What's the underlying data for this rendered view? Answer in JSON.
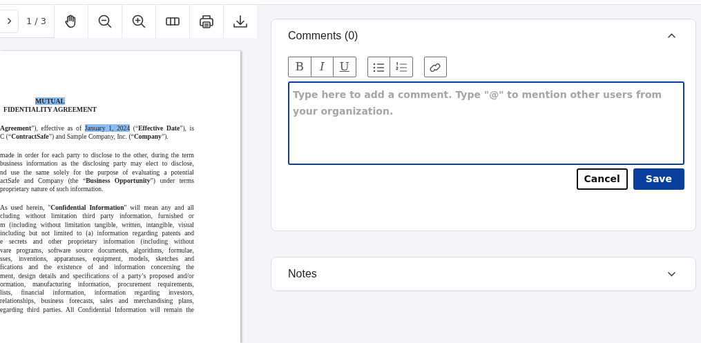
{
  "viewer": {
    "toolbar": {
      "page_indicator": "1 / 3",
      "tools": [
        {
          "kind": "hand"
        },
        {
          "kind": "zoom-out"
        },
        {
          "kind": "zoom-in"
        },
        {
          "kind": "columns"
        },
        {
          "kind": "print"
        },
        {
          "kind": "download"
        }
      ]
    },
    "document_lines": [
      {
        "kind": "heading",
        "parts": [
          {
            "text": "MUTUAL",
            "highlighted": true
          }
        ]
      },
      {
        "kind": "heading",
        "parts": [
          {
            "text": "FIDENTIALITY AGREEMENT",
            "highlighted": false
          }
        ]
      },
      {
        "kind": "gap"
      },
      {
        "kind": "justified",
        "parts": [
          {
            "text": "**Agreement**”), effective as of ",
            "highlighted": false
          },
          {
            "text": "January 1, 2024",
            "highlighted": true
          },
          {
            "text": " (“**Effective Date**”), is",
            "highlighted": false
          }
        ]
      },
      {
        "kind": "last",
        "parts": [
          {
            "text": "C (“**ContractSafe**”) and Sample Company, Inc. (“**Company**”).",
            "highlighted": false
          }
        ]
      },
      {
        "kind": "gap"
      },
      {
        "kind": "justified",
        "parts": [
          {
            "text": "made in order for each party to disclose to the other, during the term",
            "highlighted": false
          }
        ]
      },
      {
        "kind": "justified",
        "parts": [
          {
            "text": "business information as the disclosing party may elect to disclose,",
            "highlighted": false
          }
        ]
      },
      {
        "kind": "justified",
        "parts": [
          {
            "text": "nd use the same solely for the purpose of evaluating a potential",
            "highlighted": false
          }
        ]
      },
      {
        "kind": "justified",
        "parts": [
          {
            "text": "actSafe and Company (the “**Business Opportunity**”) under terms",
            "highlighted": false
          }
        ]
      },
      {
        "kind": "last",
        "parts": [
          {
            "text": "proprietary nature of such information.",
            "highlighted": false
          }
        ]
      },
      {
        "kind": "gap"
      },
      {
        "kind": "justified",
        "parts": [
          {
            "text": "As used herein, \"**Confidential Information**\" will mean any and all",
            "highlighted": false
          }
        ]
      },
      {
        "kind": "justified",
        "parts": [
          {
            "text": "cluding without limitation third party information, furnished or",
            "highlighted": false
          }
        ]
      },
      {
        "kind": "justified",
        "parts": [
          {
            "text": "m (including without limitation tangible, written, intangible, visual",
            "highlighted": false
          }
        ]
      },
      {
        "kind": "justified",
        "parts": [
          {
            "text": "including but not limited to (a) information regarding patents and",
            "highlighted": false
          }
        ]
      },
      {
        "kind": "justified",
        "parts": [
          {
            "text": "e secrets and other proprietary information (including without",
            "highlighted": false
          }
        ]
      },
      {
        "kind": "justified",
        "parts": [
          {
            "text": "vare programs, software source documents, algorithms, formulae,",
            "highlighted": false
          }
        ]
      },
      {
        "kind": "justified",
        "parts": [
          {
            "text": "sses, inventions, apparatuses, equipment, models, sketches and",
            "highlighted": false
          }
        ]
      },
      {
        "kind": "justified",
        "parts": [
          {
            "text": "fications and the existence of and information concerning the",
            "highlighted": false
          }
        ]
      },
      {
        "kind": "justified",
        "parts": [
          {
            "text": "ment, design details and specifications of a party’s proposed and/or",
            "highlighted": false
          }
        ]
      },
      {
        "kind": "justified",
        "parts": [
          {
            "text": "ormation, manufacturing information, procurement requirements,",
            "highlighted": false
          }
        ]
      },
      {
        "kind": "justified",
        "parts": [
          {
            "text": "lists, financial information, information regarding investors,",
            "highlighted": false
          }
        ]
      },
      {
        "kind": "justified",
        "parts": [
          {
            "text": "relationships, business forecasts, sales and merchandising plans,",
            "highlighted": false
          }
        ]
      },
      {
        "kind": "justified",
        "parts": [
          {
            "text": "egarding third parties.  All Confidential Information will remain the",
            "highlighted": false
          }
        ]
      }
    ]
  },
  "comments": {
    "title": "Comments (0)",
    "expanded": true,
    "format_groups": [
      [
        {
          "kind": "bold",
          "label": "B"
        },
        {
          "kind": "italic",
          "label": "I"
        },
        {
          "kind": "underline",
          "label": "U"
        }
      ],
      [
        {
          "kind": "bullet-list"
        },
        {
          "kind": "numbered-list"
        }
      ],
      [
        {
          "kind": "link"
        }
      ]
    ],
    "editor": {
      "placeholder": "Type here to add a comment. Type \"@\" to mention other users from your organization."
    },
    "buttons": [
      {
        "kind": "secondary",
        "label": "Cancel"
      },
      {
        "kind": "primary",
        "label": "Save"
      }
    ]
  },
  "notes": {
    "title": "Notes",
    "expanded": false
  }
}
